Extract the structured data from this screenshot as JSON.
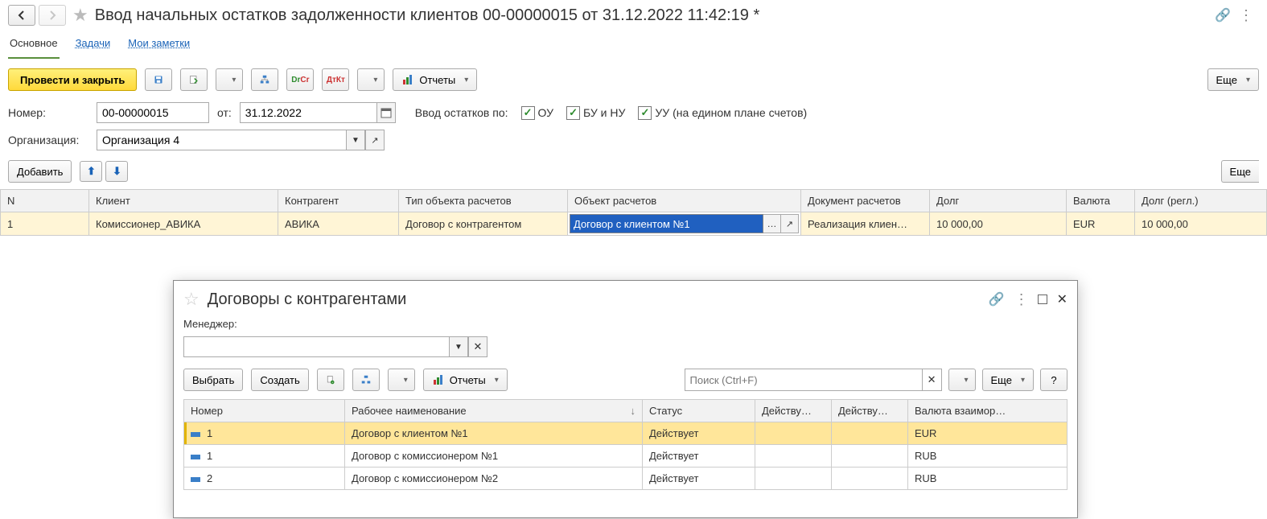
{
  "header": {
    "title": "Ввод начальных остатков задолженности клиентов 00-00000015 от 31.12.2022 11:42:19 *"
  },
  "tabs": {
    "main": "Основное",
    "tasks": "Задачи",
    "notes": "Мои заметки"
  },
  "toolbar": {
    "post_close": "Провести и закрыть",
    "reports": "Отчеты",
    "more": "Еще"
  },
  "form": {
    "number_label": "Номер:",
    "number": "00-00000015",
    "from_label": "от:",
    "date": "31.12.2022",
    "balances_by_label": "Ввод остатков по:",
    "chk_ou": "ОУ",
    "chk_bu": "БУ и НУ",
    "chk_uu": "УУ (на едином плане счетов)",
    "org_label": "Организация:",
    "org": "Организация 4"
  },
  "table_toolbar": {
    "add": "Добавить",
    "more": "Еще"
  },
  "grid": {
    "columns": {
      "n": "N",
      "client": "Клиент",
      "counterparty": "Контрагент",
      "obj_type": "Тип объекта расчетов",
      "obj": "Объект расчетов",
      "doc": "Документ расчетов",
      "debt": "Долг",
      "currency": "Валюта",
      "debt_regl": "Долг (регл.)"
    },
    "row": {
      "n": "1",
      "client": "Комиссионер_АВИКА",
      "counterparty": "АВИКА",
      "obj_type": "Договор с контрагентом",
      "obj": "Договор с клиентом №1",
      "doc": "Реализация клиен…",
      "debt": "10 000,00",
      "currency": "EUR",
      "debt_regl": "10 000,00"
    }
  },
  "popup": {
    "title": "Договоры с контрагентами",
    "manager_label": "Менеджер:",
    "manager_value": "",
    "select": "Выбрать",
    "create": "Создать",
    "reports": "Отчеты",
    "search_placeholder": "Поиск (Ctrl+F)",
    "more": "Еще",
    "help": "?",
    "columns": {
      "number": "Номер",
      "name": "Рабочее наименование",
      "status": "Статус",
      "valid_from": "Действу…",
      "valid_to": "Действу…",
      "currency": "Валюта взаимор…"
    },
    "rows": [
      {
        "number": "1",
        "name": "Договор с клиентом №1",
        "status": "Действует",
        "currency": "EUR"
      },
      {
        "number": "1",
        "name": "Договор с комиссионером №1",
        "status": "Действует",
        "currency": "RUB"
      },
      {
        "number": "2",
        "name": "Договор с комиссионером №2",
        "status": "Действует",
        "currency": "RUB"
      }
    ]
  }
}
